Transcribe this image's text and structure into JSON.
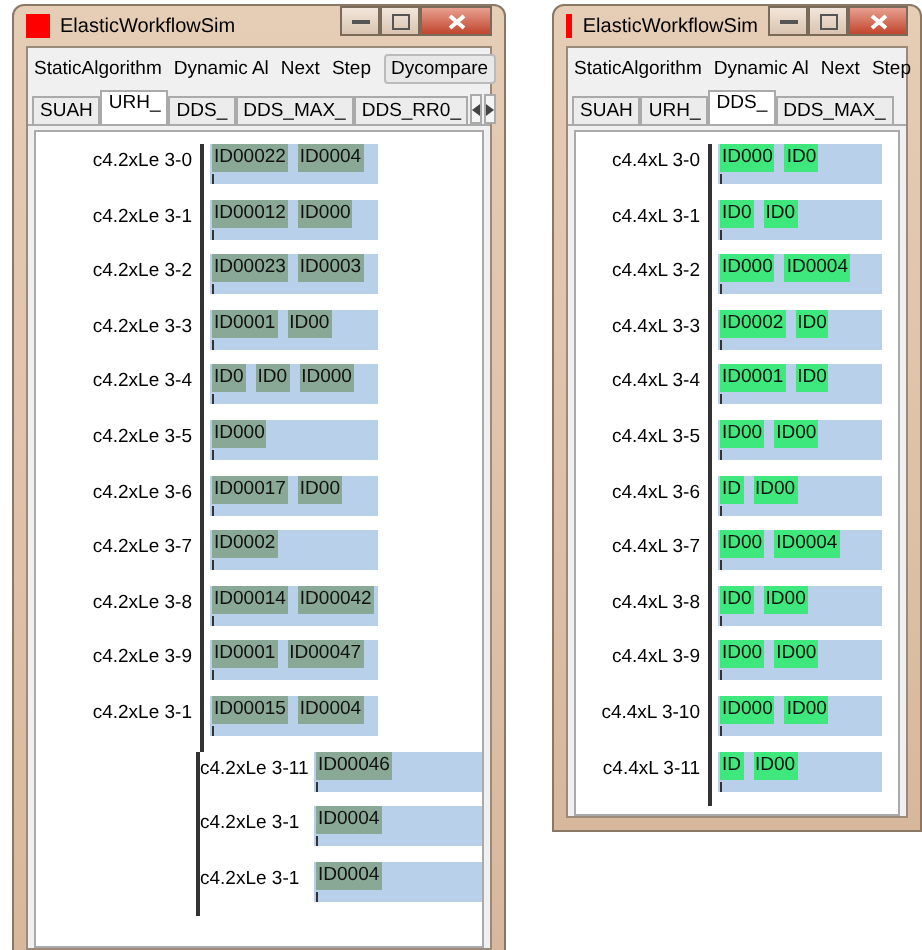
{
  "windows": [
    {
      "title": "ElasticWorkflowSim",
      "color": "#8aa896",
      "menu": [
        {
          "label": "StaticAlgorithm",
          "kind": "item"
        },
        {
          "label": "Dynamic Al",
          "kind": "item"
        },
        {
          "label": "Next",
          "kind": "item"
        },
        {
          "label": "Step",
          "kind": "item"
        },
        {
          "label": "Dycompare",
          "kind": "button"
        }
      ],
      "tabs": [
        {
          "label": "SUAH",
          "selected": false
        },
        {
          "label": "URH_",
          "selected": true
        },
        {
          "label": "DDS_",
          "selected": false
        },
        {
          "label": "DDS_MAX_",
          "selected": false
        },
        {
          "label": "DDS_RR0_",
          "selected": false
        }
      ],
      "rows": [
        {
          "label": "c4.2xLe 3-0",
          "kind": "normal",
          "tasks": [
            "ID00022",
            "ID0004"
          ]
        },
        {
          "label": "c4.2xLe 3-1",
          "kind": "normal",
          "tasks": [
            "ID00012",
            "ID000"
          ]
        },
        {
          "label": "c4.2xLe 3-2",
          "kind": "normal",
          "tasks": [
            "ID00023",
            "ID0003"
          ]
        },
        {
          "label": "c4.2xLe 3-3",
          "kind": "normal",
          "tasks": [
            "ID0001",
            "ID00"
          ]
        },
        {
          "label": "c4.2xLe 3-4",
          "kind": "normal",
          "tasks": [
            "ID0",
            "ID0",
            "ID000"
          ]
        },
        {
          "label": "c4.2xLe 3-5",
          "kind": "normal",
          "tasks": [
            "ID000"
          ]
        },
        {
          "label": "c4.2xLe 3-6",
          "kind": "normal",
          "tasks": [
            "ID00017",
            "ID00"
          ]
        },
        {
          "label": "c4.2xLe 3-7",
          "kind": "normal",
          "tasks": [
            "ID0002"
          ]
        },
        {
          "label": "c4.2xLe 3-8",
          "kind": "normal",
          "tasks": [
            "ID00014",
            "ID00042"
          ]
        },
        {
          "label": "c4.2xLe 3-9",
          "kind": "normal",
          "tasks": [
            "ID0001",
            "ID00047"
          ]
        },
        {
          "label": "c4.2xLe 3-1",
          "kind": "normal",
          "tasks": [
            "ID00015",
            "ID0004"
          ]
        },
        {
          "label": "c4.2xLe 3-11",
          "kind": "shifted",
          "tasks": [
            "ID00046"
          ]
        },
        {
          "label": "c4.2xLe 3-1",
          "kind": "shifted",
          "tasks": [
            "ID0004"
          ]
        },
        {
          "label": "c4.2xLe 3-1",
          "kind": "shifted",
          "tasks": [
            "ID0004"
          ]
        }
      ]
    },
    {
      "title": "ElasticWorkflowSim",
      "color": "#3ee87c",
      "menu": [
        {
          "label": "StaticAlgorithm",
          "kind": "item"
        },
        {
          "label": "Dynamic Al",
          "kind": "item"
        },
        {
          "label": "Next",
          "kind": "item"
        },
        {
          "label": "Step",
          "kind": "item"
        }
      ],
      "tabs": [
        {
          "label": "SUAH",
          "selected": false
        },
        {
          "label": "URH_",
          "selected": false
        },
        {
          "label": "DDS_",
          "selected": true
        },
        {
          "label": "DDS_MAX_",
          "selected": false
        }
      ],
      "rows": [
        {
          "label": "c4.4xL 3-0",
          "kind": "normal",
          "tasks": [
            "ID000",
            "ID0"
          ]
        },
        {
          "label": "c4.4xL 3-1",
          "kind": "normal",
          "tasks": [
            "ID0",
            "ID0"
          ]
        },
        {
          "label": "c4.4xL 3-2",
          "kind": "normal",
          "tasks": [
            "ID000",
            "ID0004"
          ]
        },
        {
          "label": "c4.4xL 3-3",
          "kind": "normal",
          "tasks": [
            "ID0002",
            "ID0"
          ]
        },
        {
          "label": "c4.4xL 3-4",
          "kind": "normal",
          "tasks": [
            "ID0001",
            "ID0"
          ]
        },
        {
          "label": "c4.4xL 3-5",
          "kind": "normal",
          "tasks": [
            "ID00",
            "ID00"
          ]
        },
        {
          "label": "c4.4xL 3-6",
          "kind": "normal",
          "tasks": [
            "ID",
            "ID00"
          ]
        },
        {
          "label": "c4.4xL 3-7",
          "kind": "normal",
          "tasks": [
            "ID00",
            "ID0004"
          ]
        },
        {
          "label": "c4.4xL 3-8",
          "kind": "normal",
          "tasks": [
            "ID0",
            "ID00"
          ]
        },
        {
          "label": "c4.4xL 3-9",
          "kind": "normal",
          "tasks": [
            "ID00",
            "ID00"
          ]
        },
        {
          "label": "c4.4xL 3-10",
          "kind": "normal",
          "tasks": [
            "ID000",
            "ID00"
          ]
        },
        {
          "label": "c4.4xL 3-11",
          "kind": "normal",
          "tasks": [
            "ID",
            "ID00"
          ]
        }
      ]
    }
  ]
}
